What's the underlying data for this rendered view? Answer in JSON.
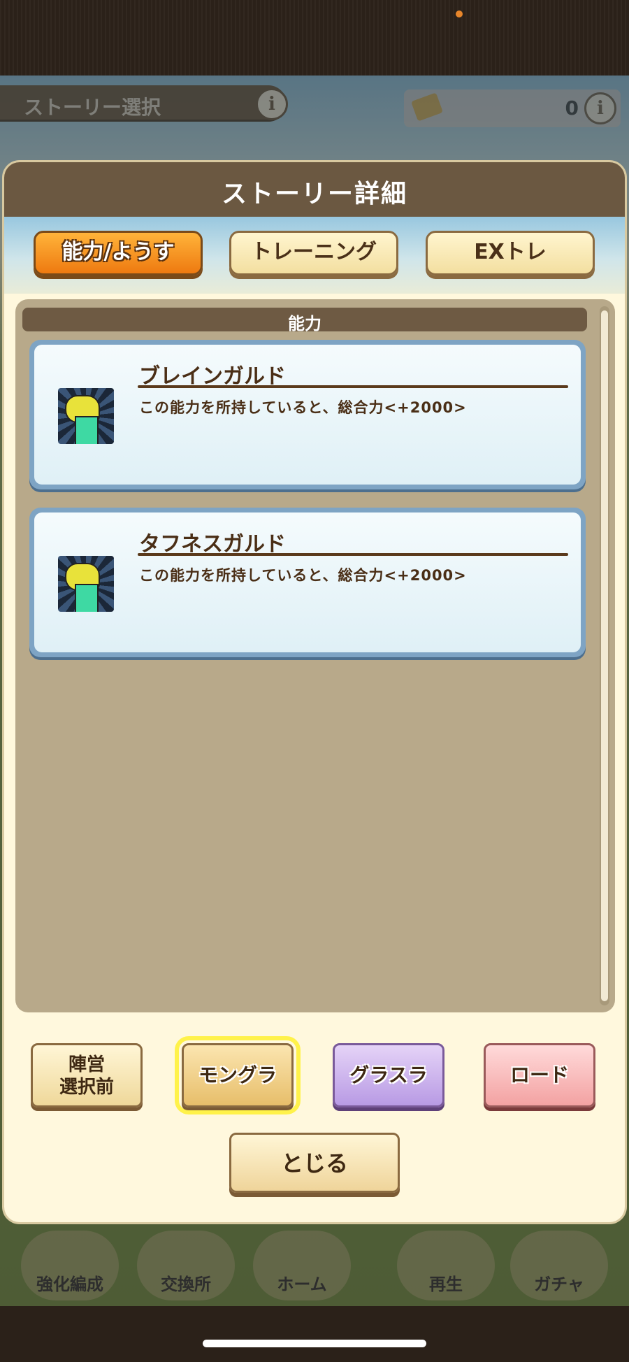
{
  "background": {
    "story_select_label": "ストーリー選択",
    "ticket_count": "0",
    "nav_items": [
      "強化編成",
      "交換所",
      "ホーム",
      "再生",
      "ガチャ"
    ]
  },
  "modal": {
    "title": "ストーリー詳細",
    "tabs": [
      {
        "label": "能力/ようす",
        "active": true
      },
      {
        "label": "トレーニング",
        "active": false
      },
      {
        "label": "EXトレ",
        "active": false
      }
    ],
    "panel_label": "能力",
    "abilities": [
      {
        "name": "ブレインガルド",
        "description": "この能力を所持していると、総合力<+2000>",
        "icon": "yellow-dragon-icon"
      },
      {
        "name": "タフネスガルド",
        "description": "この能力を所持していると、総合力<+2000>",
        "icon": "yellow-dragon-icon"
      }
    ],
    "source_buttons": [
      {
        "line1": "陣営",
        "line2": "選択前"
      },
      {
        "label": "モングラ",
        "selected": true
      },
      {
        "label": "グラスラ"
      },
      {
        "label": "ロード"
      }
    ],
    "close_label": "とじる"
  },
  "colors": {
    "header": "#6b5841",
    "active_tab": "#ee7a10",
    "card_border": "#7ea4c4",
    "highlight": "#fff24a"
  }
}
